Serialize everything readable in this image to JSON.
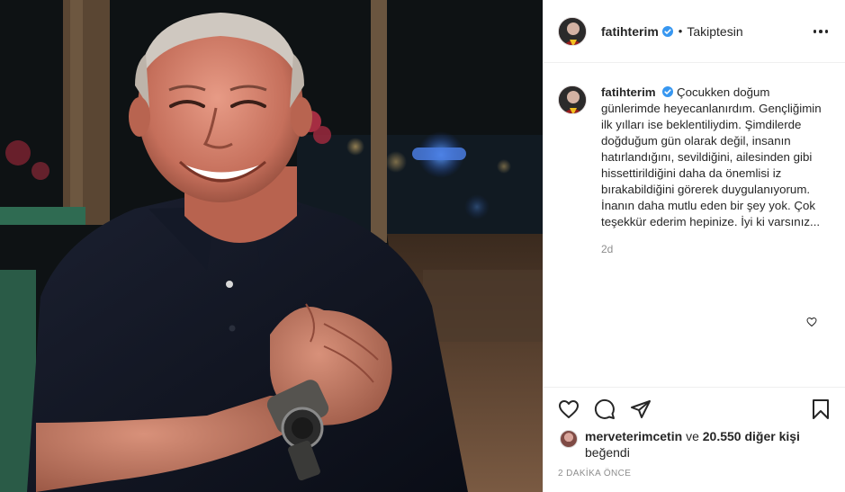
{
  "post": {
    "username": "fatihterim",
    "follow_state": "Takiptesin",
    "separator": "•"
  },
  "caption": {
    "username": "fatihterim",
    "text": "Çocukken doğum günlerimde heyecanlanırdım. Gençliğimin ilk yılları ise beklentiliydim. Şimdilerde doğduğum gün olarak değil, insanın hatırlandığını, sevildiğini, ailesinden gibi hissettirildiğini daha da önemlisi iz bırakabildiğini görerek duygulanıyorum. İnanın daha mutlu eden bir şey yok. Çok teşekkür ederim hepinize. İyi ki varsınız...",
    "time": "2d"
  },
  "likes": {
    "liker": "merveterimcetin",
    "conjunction": "ve",
    "others": "20.550 diğer kişi",
    "liked_word": "beğendi"
  },
  "posted_time": "2 DAKİKA ÖNCE",
  "icons": {
    "verified": "verified-badge-icon",
    "more": "more-options-icon",
    "like": "heart-icon",
    "comment": "comment-icon",
    "share": "share-icon",
    "save": "bookmark-icon"
  },
  "colors": {
    "verified_blue": "#3897f0",
    "text": "#262626",
    "muted": "#8e8e8e",
    "border": "#efefef"
  }
}
